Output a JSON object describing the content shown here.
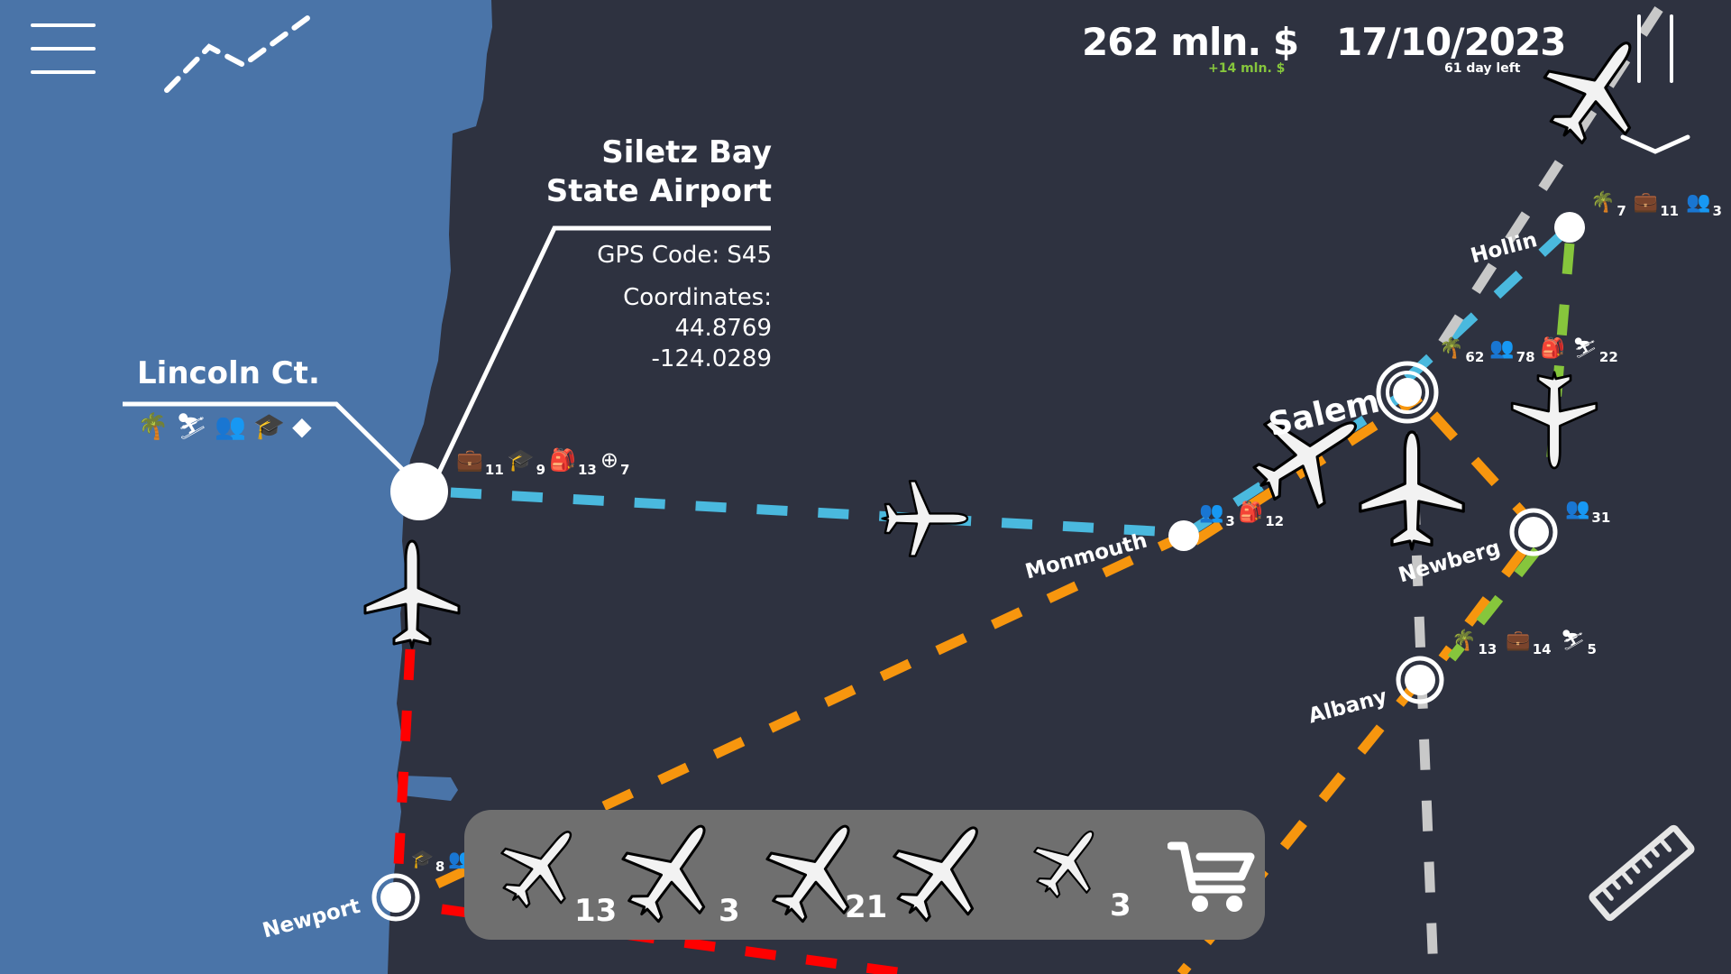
{
  "colors": {
    "water": "#4a74a8",
    "land": "#2e3240",
    "route_blue": "#4ab9de",
    "route_orange": "#f7960e",
    "route_red": "#ff0000",
    "route_green": "#86c63c",
    "route_gray": "#c8c8c8",
    "money_delta": "#86c63c",
    "fleet_panel": "#6f6f6f"
  },
  "hud": {
    "money": "262 mln. $",
    "money_delta": "+14 mln. $",
    "date": "17/10/2023",
    "days_left": "61 day left",
    "menu_icon": "hamburger-menu-icon",
    "stats_icon": "line-chart-icon",
    "pause_icon": "pause-icon",
    "speed_icon": "chevron-down-icon"
  },
  "selected_airport": {
    "name_line1": "Siletz Bay",
    "name_line2": "State Airport",
    "gps_code": "GPS Code: S45",
    "coordinates_label": "Coordinates:",
    "latitude": "44.8769",
    "longitude": "-124.0289"
  },
  "lincoln": {
    "name": "Lincoln Ct.",
    "amenities": [
      "palm-tree-icon",
      "skiing-icon",
      "people-icon",
      "graduation-cap-icon",
      "diamond-icon"
    ],
    "demand": [
      {
        "icon": "briefcase-icon",
        "value": "11"
      },
      {
        "icon": "graduation-cap-icon",
        "value": "9"
      },
      {
        "icon": "backpack-icon",
        "value": "13"
      },
      {
        "icon": "medical-kit-icon",
        "value": "7"
      }
    ]
  },
  "cities": [
    {
      "name": "Monmouth",
      "demand": [
        {
          "icon": "people-icon",
          "value": "3"
        },
        {
          "icon": "backpack-icon",
          "value": "12"
        }
      ]
    },
    {
      "name": "Salem",
      "demand": [
        {
          "icon": "palm-tree-icon",
          "value": "62"
        },
        {
          "icon": "people-icon",
          "value": "78"
        },
        {
          "icon": "backpack-icon",
          "value": ""
        },
        {
          "icon": "skiing-icon",
          "value": "22"
        }
      ]
    },
    {
      "name": "Hollin",
      "demand": [
        {
          "icon": "palm-tree-icon",
          "value": "7"
        },
        {
          "icon": "briefcase-icon",
          "value": "11"
        },
        {
          "icon": "people-icon",
          "value": "3"
        }
      ]
    },
    {
      "name": "Newberg",
      "demand": [
        {
          "icon": "people-icon",
          "value": "31"
        }
      ]
    },
    {
      "name": "Albany",
      "demand": [
        {
          "icon": "palm-tree-icon",
          "value": "13"
        },
        {
          "icon": "briefcase-icon",
          "value": "14"
        },
        {
          "icon": "skiing-icon",
          "value": "5"
        }
      ]
    },
    {
      "name": "Newport",
      "demand": [
        {
          "icon": "graduation-cap-icon",
          "value": "8"
        },
        {
          "icon": "people-icon",
          "value": ""
        }
      ]
    }
  ],
  "fleet": [
    {
      "type": "turboprop-plane-icon",
      "count": "13"
    },
    {
      "type": "widebody-jet-icon",
      "count": "3"
    },
    {
      "type": "regional-jet-icon",
      "count": "21"
    },
    {
      "type": "narrowbody-jet-icon",
      "count": ""
    },
    {
      "type": "small-turboprop-icon",
      "count": "3"
    }
  ],
  "shop_icon": "shopping-cart-icon",
  "ruler_icon": "ruler-icon"
}
